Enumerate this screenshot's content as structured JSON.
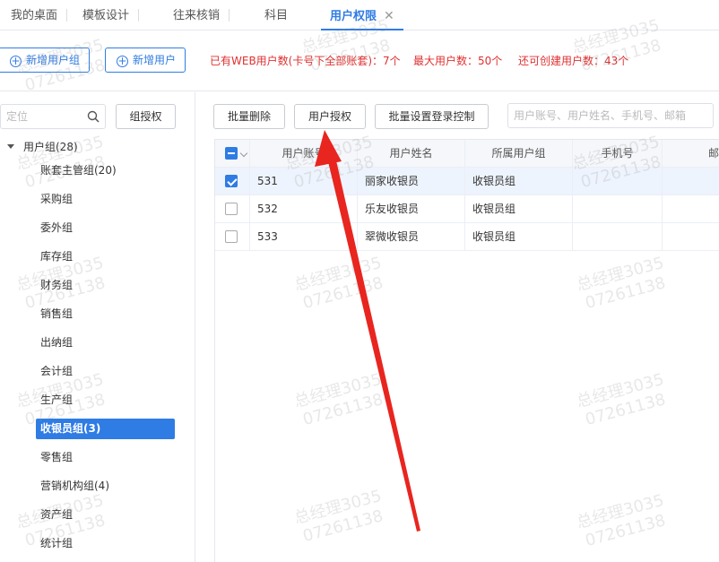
{
  "tabs": [
    {
      "label": "我的桌面"
    },
    {
      "label": "模板设计"
    },
    {
      "label": "往来核销"
    },
    {
      "label": "科目"
    },
    {
      "label": "用户权限",
      "active": true,
      "close": "✕"
    }
  ],
  "toolbar": {
    "add_group_label": "新增用户组",
    "add_user_label": "新增用户",
    "stat_web_users": "已有WEB用户数(卡号下全部账套)：7个",
    "stat_max_users": "最大用户数：50个",
    "stat_remaining": "还可创建用户数：43个"
  },
  "left": {
    "search_placeholder": "定位",
    "group_auth_label": "组授权",
    "tree_root": "用户组(28)",
    "tree_items": [
      "账套主管组(20)",
      "采购组",
      "委外组",
      "库存组",
      "财务组",
      "销售组",
      "出纳组",
      "会计组",
      "生产组",
      "收银员组(3)",
      "零售组",
      "营销机构组(4)",
      "资产组",
      "统计组"
    ],
    "selected_index": 9
  },
  "right": {
    "batch_delete_label": "批量删除",
    "user_auth_label": "用户授权",
    "batch_login_label": "批量设置登录控制",
    "filter_placeholder": "用户账号、用户姓名、手机号、邮箱",
    "columns": [
      "用户账号",
      "用户姓名",
      "所属用户组",
      "手机号",
      "邮"
    ],
    "rows": [
      {
        "account": "531",
        "name": "丽家收银员",
        "group": "收银员组",
        "phone": "",
        "checked": true
      },
      {
        "account": "532",
        "name": "乐友收银员",
        "group": "收银员组",
        "phone": "",
        "checked": false
      },
      {
        "account": "533",
        "name": "翠微收银员",
        "group": "收银员组",
        "phone": "",
        "checked": false
      }
    ]
  },
  "watermark": {
    "line1": "总经理3035",
    "line2": "07261138"
  },
  "colors": {
    "accent": "#2f7ce4",
    "alert": "#e03030",
    "annotation_arrow": "#e8251f"
  }
}
